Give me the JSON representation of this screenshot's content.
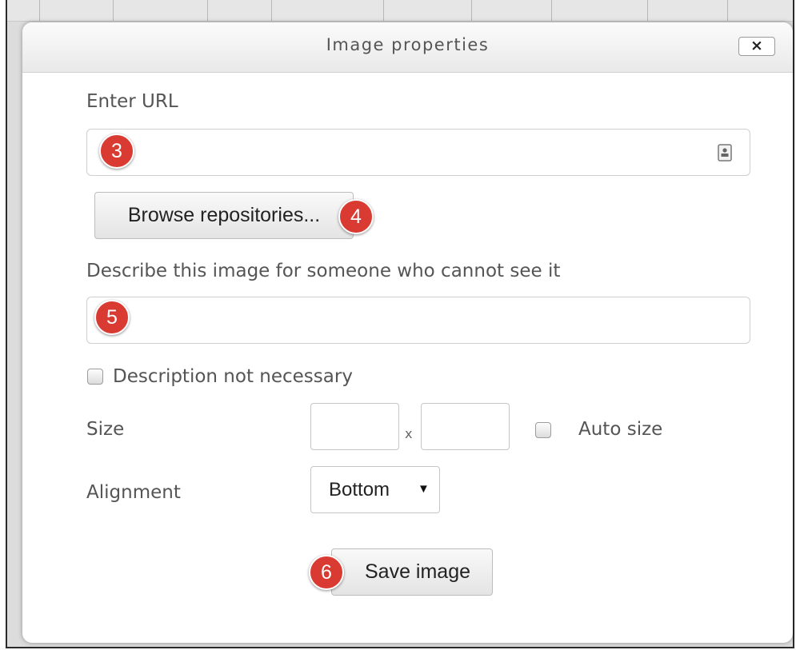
{
  "dialog": {
    "title": "Image properties",
    "close_label": "×"
  },
  "url_section": {
    "label": "Enter URL",
    "value": "",
    "placeholder": "",
    "annotation": "3"
  },
  "browse": {
    "label": "Browse repositories...",
    "annotation": "4"
  },
  "description": {
    "label": "Describe this image for someone who cannot see it",
    "value": "",
    "annotation": "5"
  },
  "not_necessary": {
    "label": "Description not necessary",
    "checked": false
  },
  "size": {
    "label": "Size",
    "width": "",
    "height": "",
    "separator": "x",
    "auto_label": "Auto size",
    "auto_checked": false
  },
  "alignment": {
    "label": "Alignment",
    "selected": "Bottom",
    "arrow": "▼"
  },
  "save": {
    "label": "Save image",
    "annotation": "6"
  },
  "colors": {
    "badge": "#d93a32",
    "label_text": "#555555"
  }
}
